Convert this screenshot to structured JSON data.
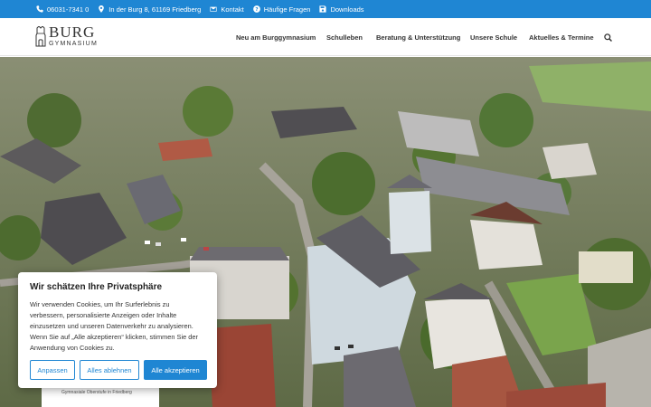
{
  "topbar": {
    "phone": "06031-7341 0",
    "address": "In der Burg 8, 61169 Friedberg",
    "contact": "Kontakt",
    "faq": "Häufige Fragen",
    "downloads": "Downloads",
    "bg_color": "#1f86d3"
  },
  "header": {
    "logo_big": "BURG",
    "logo_small": "GYMNASIUM",
    "nav": [
      {
        "label": "Neu am Burggymnasium"
      },
      {
        "label": "Schulleben"
      },
      {
        "label": "Beratung & Unterstützung"
      },
      {
        "label": "Unsere Schule"
      },
      {
        "label": "Aktuelles & Termine"
      }
    ],
    "search_icon": "search-icon"
  },
  "hero": {
    "caption": "Gymnasiale Oberstufe in Friedberg"
  },
  "cookie": {
    "title": "Wir schätzen Ihre Privatsphäre",
    "text": "Wir verwenden Cookies, um Ihr Surferlebnis zu verbessern, personalisierte Anzeigen oder Inhalte einzusetzen und unseren Datenverkehr zu analysieren. Wenn Sie auf „Alle akzeptieren“ klicken, stimmen Sie der Anwendung von Cookies zu.",
    "customize": "Anpassen",
    "reject": "Alles ablehnen",
    "accept": "Alle akzeptieren",
    "accent_color": "#1f86d3"
  }
}
